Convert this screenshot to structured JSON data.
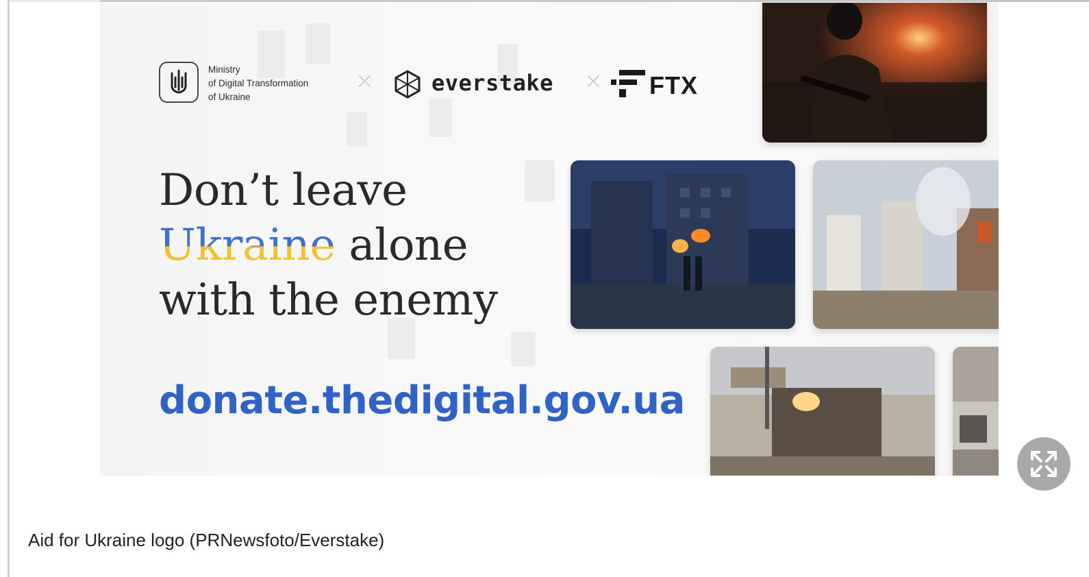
{
  "banner": {
    "ministry_lines": [
      "Ministry",
      "of Digital Transformation",
      "of Ukraine"
    ],
    "separator": "×",
    "everstake_label": "everstake",
    "ftx_label": "FTX",
    "headline": {
      "line1": "Don’t leave",
      "line2_highlight": "Ukraine",
      "line2_rest": " alone",
      "line3": "with the enemy"
    },
    "donate_url": "donate.thedigital.gov.ua",
    "colors": {
      "ukraine_blue": "#3f6fcf",
      "ukraine_yellow": "#f1c232",
      "url_blue": "#2f63c8"
    }
  },
  "caption": "Aid for Ukraine logo (PRNewsfoto/Everstake)",
  "icons": {
    "expand": "expand-arrows-icon",
    "ministry": "trident-icon",
    "everstake": "everstake-logo-icon",
    "ftx": "ftx-logo-icon"
  }
}
